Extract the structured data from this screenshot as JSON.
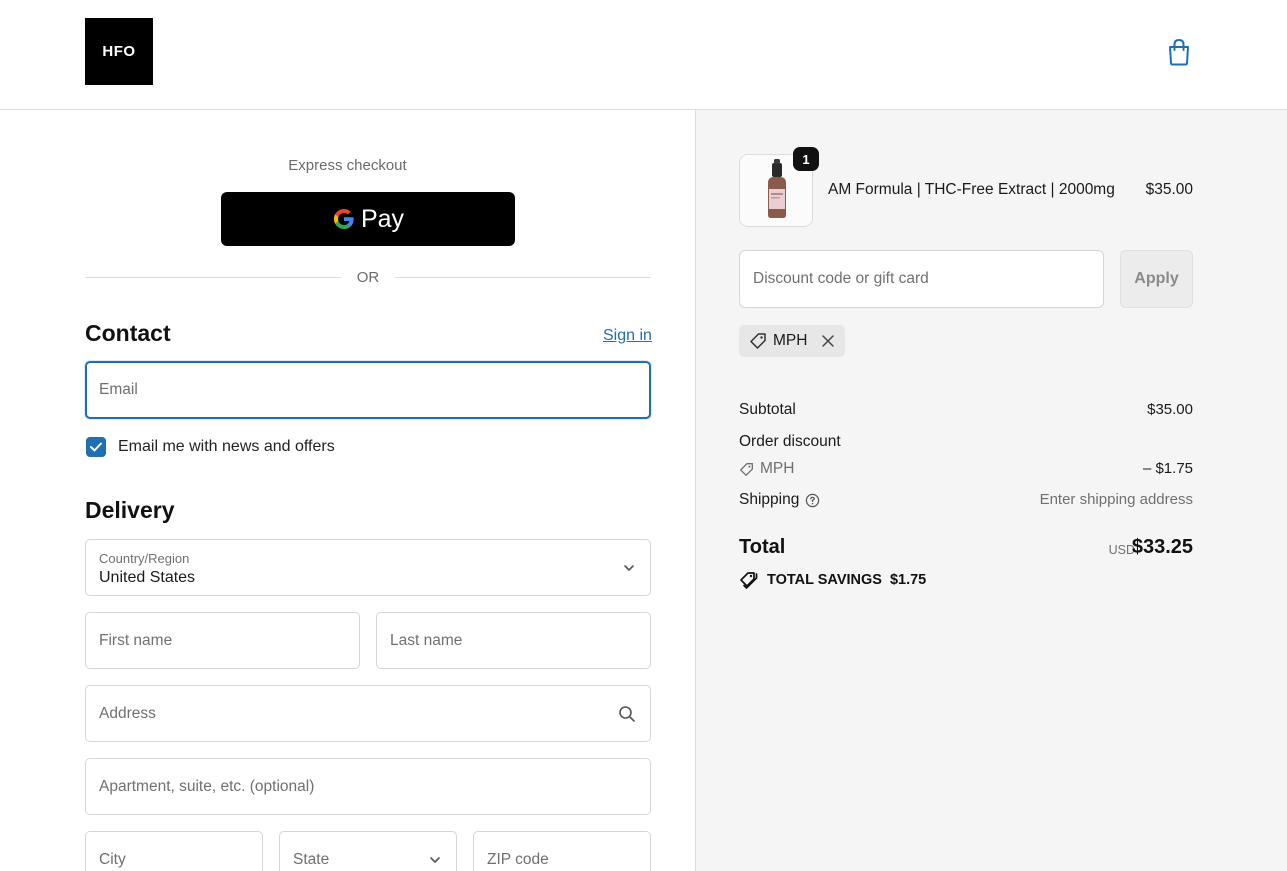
{
  "header": {
    "logo_text": "HFO",
    "cart_icon": "shopping-bag-icon"
  },
  "express": {
    "label": "Express checkout",
    "gpay_label": "Pay",
    "or_label": "OR"
  },
  "contact": {
    "title": "Contact",
    "signin_label": "Sign in",
    "email_placeholder": "Email",
    "newsletter_checked": true,
    "newsletter_label": "Email me with news and offers"
  },
  "delivery": {
    "title": "Delivery",
    "country_label": "Country/Region",
    "country_value": "United States",
    "first_name_placeholder": "First name",
    "last_name_placeholder": "Last name",
    "address_placeholder": "Address",
    "apartment_placeholder": "Apartment, suite, etc. (optional)",
    "city_placeholder": "City",
    "state_placeholder": "State",
    "zip_placeholder": "ZIP code"
  },
  "summary": {
    "product": {
      "quantity": "1",
      "title": "AM Formula | THC-Free Extract | 2000mg",
      "price": "$35.00"
    },
    "discount_placeholder": "Discount code or gift card",
    "apply_label": "Apply",
    "applied_code": "MPH",
    "subtotal_label": "Subtotal",
    "subtotal_value": "$35.00",
    "order_discount_label": "Order discount",
    "order_discount_code": "MPH",
    "order_discount_value": "– $1.75",
    "shipping_label": "Shipping",
    "shipping_value": "Enter shipping address",
    "total_label": "Total",
    "total_currency": "USD",
    "total_value": "$33.25",
    "savings_label": "TOTAL SAVINGS",
    "savings_value": "$1.75"
  },
  "colors": {
    "accent": "#1f6fb2",
    "summary_bg": "#f5f5f5",
    "button_black": "#000000"
  }
}
